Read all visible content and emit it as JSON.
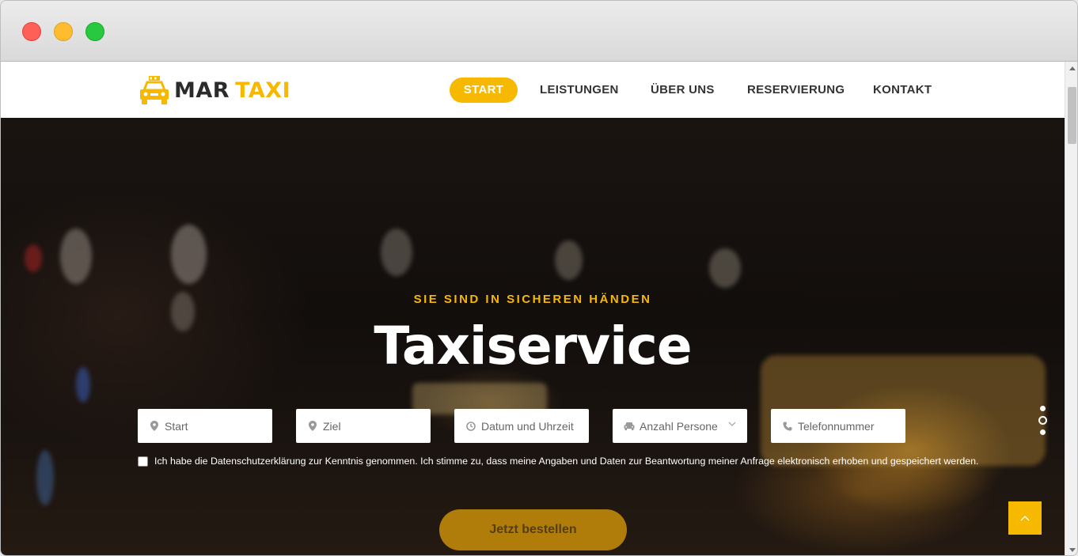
{
  "brand": {
    "name_part1": "MAR",
    "name_part2": "TAXI",
    "accent_color": "#f7b900"
  },
  "nav": {
    "items": [
      {
        "label": "START",
        "active": true
      },
      {
        "label": "LEISTUNGEN",
        "active": false
      },
      {
        "label": "ÜBER UNS",
        "active": false
      },
      {
        "label": "RESERVIERUNG",
        "active": false
      },
      {
        "label": "KONTAKT",
        "active": false
      }
    ]
  },
  "hero": {
    "subtitle": "SIE SIND IN SICHEREN HÄNDEN",
    "title": "Taxiservice"
  },
  "form": {
    "fields": [
      {
        "placeholder": "Start",
        "icon": "map-marker-icon"
      },
      {
        "placeholder": "Ziel",
        "icon": "map-marker-icon"
      },
      {
        "placeholder": "Datum und Uhrzeit",
        "icon": "clock-icon"
      },
      {
        "placeholder": "Anzahl Persone",
        "icon": "car-icon",
        "select": true
      },
      {
        "placeholder": "Telefonnummer",
        "icon": "phone-icon"
      }
    ],
    "consent": "Ich habe die Datenschutzerklärung zur Kenntnis genommen. Ich stimme zu, dass meine Angaben und Daten zur Beantwortung meiner Anfrage elektronisch erhoben und gespeichert werden.",
    "submit_label": "Jetzt bestellen"
  },
  "slider": {
    "dot_count": 3,
    "active_index": 1
  },
  "back_to_top_icon": "chevron-up-icon"
}
